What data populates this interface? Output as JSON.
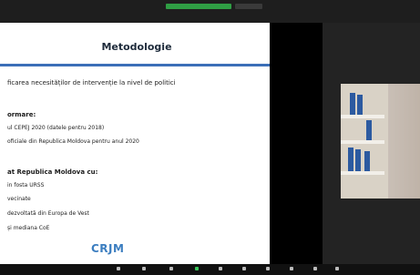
{
  "slide": {
    "title": "Metodologie",
    "lines": [
      "ficarea necesităților de intervenție la nivel de politici",
      "ormare:",
      "ul CEPEJ 2020 (datele pentru 2018)",
      "oficiale din Republica Moldova pentru anul 2020",
      "at Republica Moldova cu:",
      "in fosta URSS",
      "vecinate",
      "dezvoltată din Europa de Vest",
      "și mediana CoE"
    ],
    "logo_text": "CRJM"
  },
  "colors": {
    "accent_rule": "#3b6fb8",
    "logo": "#3c7ec0",
    "active_indicator": "#38c75a"
  },
  "toolbar": {
    "icons": [
      "mic-icon",
      "video-icon",
      "security-icon",
      "participants-icon",
      "share-screen-icon",
      "chat-icon",
      "record-icon",
      "reactions-icon",
      "more-icon",
      "leave-icon"
    ]
  }
}
